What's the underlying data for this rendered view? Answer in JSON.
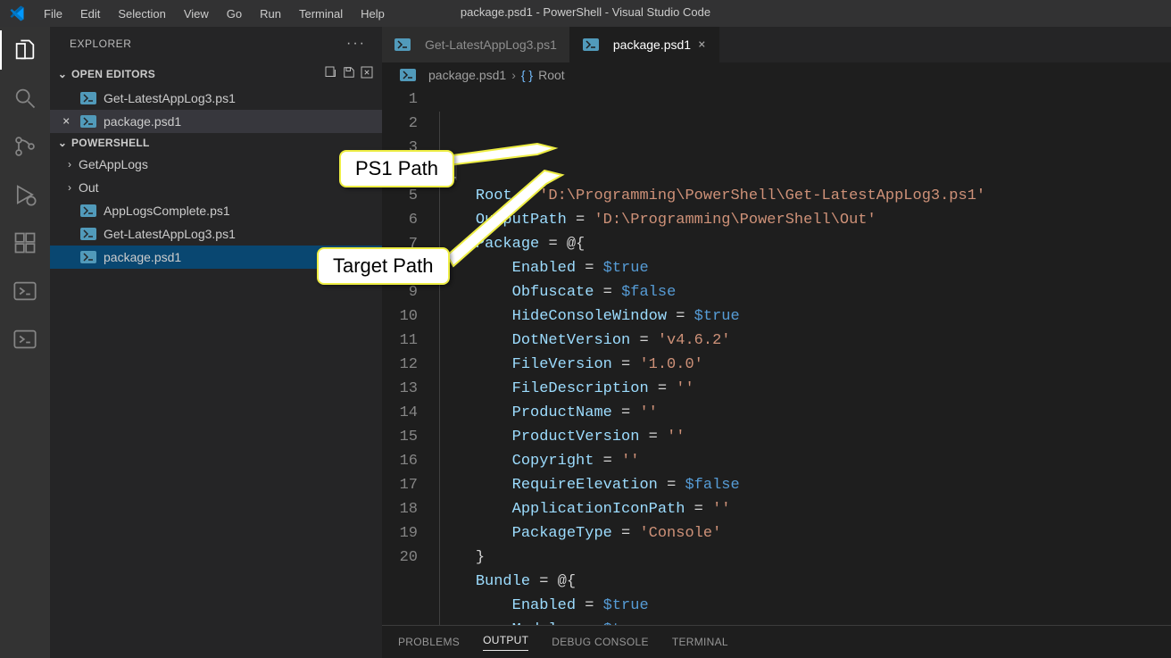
{
  "menubar": [
    "File",
    "Edit",
    "Selection",
    "View",
    "Go",
    "Run",
    "Terminal",
    "Help"
  ],
  "window_title": "package.psd1 - PowerShell - Visual Studio Code",
  "explorer": {
    "title": "EXPLORER",
    "open_editors_label": "OPEN EDITORS",
    "open_editors": [
      "Get-LatestAppLog3.ps1",
      "package.psd1"
    ],
    "project_label": "POWERSHELL",
    "tree": [
      {
        "name": "GetAppLogs",
        "type": "folder"
      },
      {
        "name": "Out",
        "type": "folder"
      },
      {
        "name": "AppLogsComplete.ps1",
        "type": "file"
      },
      {
        "name": "Get-LatestAppLog3.ps1",
        "type": "file"
      },
      {
        "name": "package.psd1",
        "type": "file",
        "selected": true
      }
    ]
  },
  "tabs": [
    {
      "label": "Get-LatestAppLog3.ps1",
      "active": false
    },
    {
      "label": "package.psd1",
      "active": true
    }
  ],
  "breadcrumb": {
    "file": "package.psd1",
    "symbol": "Root"
  },
  "code_lines": [
    {
      "n": 1,
      "html": "<span class='k-brace'>@</span><span class='k-bracehl'>{</span>"
    },
    {
      "n": 2,
      "html": "    <span class='k-var'>Root</span> <span class='k-punc'>=</span> <span class='k-str'>'D:\\Programming\\PowerShell\\Get-LatestAppLog3.ps1'</span>"
    },
    {
      "n": 3,
      "html": "    <span class='k-var'>OutputPath</span> <span class='k-punc'>=</span> <span class='k-str'>'D:\\Programming\\PowerShell\\Out'</span>"
    },
    {
      "n": 4,
      "html": "    <span class='k-var'>Package</span> <span class='k-punc'>=</span> <span class='k-brace'>@{</span>"
    },
    {
      "n": 5,
      "html": "        <span class='k-var'>Enabled</span> <span class='k-punc'>=</span> <span class='k-true'>$true</span>"
    },
    {
      "n": 6,
      "html": "        <span class='k-var'>Obfuscate</span> <span class='k-punc'>=</span> <span class='k-true'>$false</span>"
    },
    {
      "n": 7,
      "html": "        <span class='k-var'>HideConsoleWindow</span> <span class='k-punc'>=</span> <span class='k-true'>$true</span>"
    },
    {
      "n": 8,
      "html": "        <span class='k-var'>DotNetVersion</span> <span class='k-punc'>=</span> <span class='k-str'>'v4.6.2'</span>"
    },
    {
      "n": 9,
      "html": "        <span class='k-var'>FileVersion</span> <span class='k-punc'>=</span> <span class='k-str'>'1.0.0'</span>"
    },
    {
      "n": 10,
      "html": "        <span class='k-var'>FileDescription</span> <span class='k-punc'>=</span> <span class='k-str'>''</span>"
    },
    {
      "n": 11,
      "html": "        <span class='k-var'>ProductName</span> <span class='k-punc'>=</span> <span class='k-str'>''</span>"
    },
    {
      "n": 12,
      "html": "        <span class='k-var'>ProductVersion</span> <span class='k-punc'>=</span> <span class='k-str'>''</span>"
    },
    {
      "n": 13,
      "html": "        <span class='k-var'>Copyright</span> <span class='k-punc'>=</span> <span class='k-str'>''</span>"
    },
    {
      "n": 14,
      "html": "        <span class='k-var'>RequireElevation</span> <span class='k-punc'>=</span> <span class='k-true'>$false</span>"
    },
    {
      "n": 15,
      "html": "        <span class='k-var'>ApplicationIconPath</span> <span class='k-punc'>=</span> <span class='k-str'>''</span>"
    },
    {
      "n": 16,
      "html": "        <span class='k-var'>PackageType</span> <span class='k-punc'>=</span> <span class='k-str'>'Console'</span>"
    },
    {
      "n": 17,
      "html": "    <span class='k-brace'>}</span>"
    },
    {
      "n": 18,
      "html": "    <span class='k-var'>Bundle</span> <span class='k-punc'>=</span> <span class='k-brace'>@{</span>"
    },
    {
      "n": 19,
      "html": "        <span class='k-var'>Enabled</span> <span class='k-punc'>=</span> <span class='k-true'>$true</span>"
    },
    {
      "n": 20,
      "html": "        <span class='k-var'>Modules</span> <span class='k-punc'>=</span> <span class='k-true'>$true</span>"
    }
  ],
  "terminal_tabs": [
    "PROBLEMS",
    "OUTPUT",
    "DEBUG CONSOLE",
    "TERMINAL"
  ],
  "annotations": {
    "ps1_label": "PS1 Path",
    "target_label": "Target Path"
  },
  "file_content_data": {
    "Root": "D:\\Programming\\PowerShell\\Get-LatestAppLog3.ps1",
    "OutputPath": "D:\\Programming\\PowerShell\\Out",
    "Package": {
      "Enabled": true,
      "Obfuscate": false,
      "HideConsoleWindow": true,
      "DotNetVersion": "v4.6.2",
      "FileVersion": "1.0.0",
      "FileDescription": "",
      "ProductName": "",
      "ProductVersion": "",
      "Copyright": "",
      "RequireElevation": false,
      "ApplicationIconPath": "",
      "PackageType": "Console"
    },
    "Bundle": {
      "Enabled": true,
      "Modules": true
    }
  }
}
